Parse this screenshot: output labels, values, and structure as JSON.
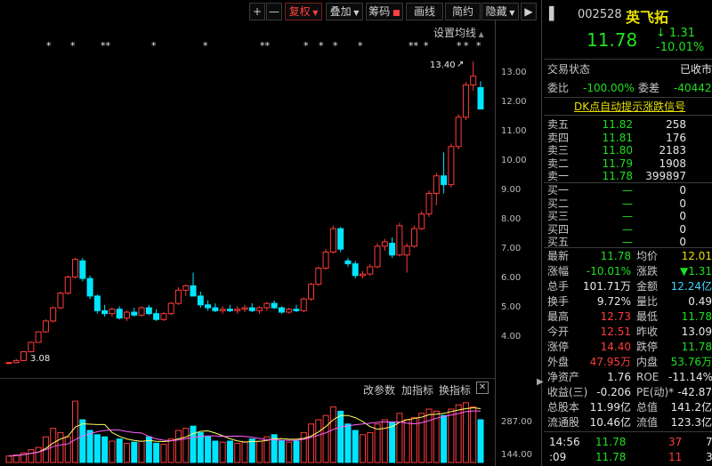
{
  "toolbar": {
    "plus": "+",
    "minus": "—",
    "fuquan": "复权",
    "diejia": "叠加",
    "chouma": "筹码",
    "huaxian": "画线",
    "jianyue": "简约",
    "yincang": "隐藏"
  },
  "chart_header": {
    "settings_link": "设置均线"
  },
  "stars": [
    {
      "t": "*"
    },
    {
      "t": "*"
    },
    {
      "t": "**"
    },
    {
      "t": "*"
    },
    {
      "t": "*"
    },
    {
      "t": "**"
    },
    {
      "t": "*"
    },
    {
      "t": "*"
    },
    {
      "t": "*"
    },
    {
      "t": "*"
    },
    {
      "t": "**"
    },
    {
      "t": "*"
    },
    {
      "t": "*"
    },
    {
      "t": "*"
    },
    {
      "t": "*"
    }
  ],
  "price_axis": [
    "13.00",
    "12.00",
    "11.00",
    "10.00",
    "9.00",
    "8.00",
    "7.00",
    "6.00",
    "5.00",
    "4.00"
  ],
  "annotations": {
    "high": "13.40",
    "low": "3.08"
  },
  "indicator_bar": {
    "change_params": "改参数",
    "add_indicator": "加指标",
    "switch_indicator": "换指标",
    "close": "✕"
  },
  "volume_axis": [
    "287.00",
    "144.00"
  ],
  "chart_data": {
    "type": "candlestick",
    "ylim": [
      3.0,
      13.8
    ],
    "candles": [
      [
        3.12,
        3.15,
        3.08,
        3.13
      ],
      [
        3.13,
        3.25,
        3.1,
        3.2
      ],
      [
        3.2,
        3.52,
        3.18,
        3.5
      ],
      [
        3.5,
        3.85,
        3.48,
        3.82
      ],
      [
        3.82,
        4.2,
        3.8,
        4.18
      ],
      [
        4.18,
        4.6,
        4.15,
        4.55
      ],
      [
        4.55,
        5.05,
        4.5,
        5.0
      ],
      [
        5.0,
        5.55,
        4.95,
        5.5
      ],
      [
        5.5,
        6.1,
        5.45,
        6.05
      ],
      [
        6.05,
        6.7,
        6.0,
        6.65
      ],
      [
        6.6,
        6.7,
        5.9,
        6.0
      ],
      [
        6.0,
        6.1,
        5.3,
        5.4
      ],
      [
        5.4,
        5.45,
        4.8,
        4.9
      ],
      [
        4.9,
        5.1,
        4.7,
        4.8
      ],
      [
        4.8,
        5.0,
        4.7,
        4.95
      ],
      [
        4.95,
        5.05,
        4.6,
        4.65
      ],
      [
        4.65,
        4.9,
        4.55,
        4.85
      ],
      [
        4.85,
        5.0,
        4.7,
        4.75
      ],
      [
        4.75,
        5.05,
        4.7,
        5.0
      ],
      [
        5.0,
        5.1,
        4.75,
        4.8
      ],
      [
        4.8,
        4.95,
        4.55,
        4.6
      ],
      [
        4.6,
        4.85,
        4.55,
        4.8
      ],
      [
        4.8,
        5.2,
        4.75,
        5.15
      ],
      [
        5.15,
        5.7,
        5.1,
        5.6
      ],
      [
        5.6,
        5.8,
        5.4,
        5.75
      ],
      [
        5.75,
        6.2,
        5.7,
        5.4
      ],
      [
        5.4,
        5.55,
        5.0,
        5.1
      ],
      [
        5.1,
        5.25,
        4.9,
        5.0
      ],
      [
        5.0,
        5.15,
        4.85,
        4.9
      ],
      [
        4.9,
        5.05,
        4.8,
        4.95
      ],
      [
        4.95,
        5.1,
        4.85,
        4.9
      ],
      [
        4.9,
        5.05,
        4.8,
        4.95
      ],
      [
        4.95,
        5.1,
        4.85,
        5.0
      ],
      [
        5.0,
        5.15,
        4.85,
        4.9
      ],
      [
        4.9,
        5.05,
        4.8,
        5.0
      ],
      [
        5.0,
        5.2,
        4.9,
        5.15
      ],
      [
        5.15,
        5.25,
        4.95,
        5.0
      ],
      [
        5.0,
        5.05,
        4.8,
        4.85
      ],
      [
        4.85,
        5.0,
        4.8,
        4.95
      ],
      [
        4.95,
        5.1,
        4.85,
        4.9
      ],
      [
        4.9,
        5.35,
        4.85,
        5.3
      ],
      [
        5.3,
        5.85,
        5.25,
        5.8
      ],
      [
        5.8,
        6.4,
        5.75,
        6.35
      ],
      [
        6.35,
        7.0,
        6.3,
        6.9
      ],
      [
        6.9,
        7.8,
        6.85,
        7.7
      ],
      [
        7.7,
        7.75,
        6.9,
        7.0
      ],
      [
        6.6,
        6.7,
        6.4,
        6.5
      ],
      [
        6.5,
        6.6,
        6.0,
        6.1
      ],
      [
        6.1,
        6.25,
        6.0,
        6.15
      ],
      [
        6.15,
        6.5,
        6.1,
        6.4
      ],
      [
        6.4,
        7.2,
        6.35,
        7.1
      ],
      [
        7.1,
        7.35,
        6.95,
        7.25
      ],
      [
        7.2,
        7.4,
        6.7,
        6.8
      ],
      [
        6.8,
        7.9,
        6.75,
        7.8
      ],
      [
        6.8,
        7.2,
        6.2,
        7.1
      ],
      [
        7.1,
        7.8,
        7.05,
        7.7
      ],
      [
        7.7,
        8.3,
        7.65,
        8.2
      ],
      [
        8.2,
        9.0,
        8.1,
        8.9
      ],
      [
        8.9,
        9.6,
        8.5,
        9.5
      ],
      [
        9.5,
        10.3,
        8.9,
        9.2
      ],
      [
        9.2,
        10.6,
        9.1,
        10.5
      ],
      [
        10.5,
        11.6,
        10.4,
        11.5
      ],
      [
        11.5,
        12.7,
        11.4,
        12.6
      ],
      [
        12.6,
        13.4,
        12.4,
        12.9
      ],
      [
        12.51,
        12.73,
        11.78,
        11.78
      ]
    ],
    "volume": [
      30,
      35,
      45,
      60,
      70,
      120,
      160,
      140,
      120,
      287,
      200,
      150,
      130,
      120,
      100,
      110,
      90,
      95,
      100,
      120,
      90,
      85,
      110,
      150,
      160,
      170,
      140,
      120,
      100,
      95,
      100,
      90,
      95,
      110,
      100,
      120,
      130,
      100,
      95,
      100,
      140,
      180,
      200,
      220,
      260,
      240,
      180,
      150,
      130,
      140,
      180,
      200,
      190,
      230,
      200,
      210,
      230,
      250,
      240,
      220,
      250,
      270,
      280,
      260,
      200
    ]
  },
  "stock": {
    "code": "002528",
    "name": "英飞拓",
    "price": "11.78",
    "change": "1.31",
    "pct": "10.01%"
  },
  "status": {
    "label": "交易状态",
    "value": "已收市"
  },
  "weibi": {
    "label1": "委比",
    "value1": "-100.00%",
    "label2": "委差",
    "value2": "-40442"
  },
  "dk_signal": "DK点自动提示涨跌信号",
  "asks": [
    {
      "label": "卖五",
      "price": "11.82",
      "vol": "258"
    },
    {
      "label": "卖四",
      "price": "11.81",
      "vol": "176"
    },
    {
      "label": "卖三",
      "price": "11.80",
      "vol": "2183"
    },
    {
      "label": "卖二",
      "price": "11.79",
      "vol": "1908"
    },
    {
      "label": "卖一",
      "price": "11.78",
      "vol": "399897"
    }
  ],
  "bids": [
    {
      "label": "买一",
      "price": "—",
      "vol": "0"
    },
    {
      "label": "买二",
      "price": "—",
      "vol": "0"
    },
    {
      "label": "买三",
      "price": "—",
      "vol": "0"
    },
    {
      "label": "买四",
      "price": "—",
      "vol": "0"
    },
    {
      "label": "买五",
      "price": "—",
      "vol": "0"
    }
  ],
  "stats": [
    {
      "l1": "最新",
      "v1": "11.78",
      "l2": "均价",
      "v2": "12.01"
    },
    {
      "l1": "涨幅",
      "v1": "-10.01%",
      "l2": "涨跌",
      "v2": "▼1.31"
    },
    {
      "l1": "总手",
      "v1": "101.71万",
      "l2": "金额",
      "v2": "12.24亿"
    },
    {
      "l1": "换手",
      "v1": "9.72%",
      "l2": "量比",
      "v2": "0.49"
    },
    {
      "l1": "最高",
      "v1": "12.73",
      "l2": "最低",
      "v2": "11.78"
    },
    {
      "l1": "今开",
      "v1": "12.51",
      "l2": "昨收",
      "v2": "13.09"
    },
    {
      "l1": "涨停",
      "v1": "14.40",
      "l2": "跌停",
      "v2": "11.78"
    },
    {
      "l1": "外盘",
      "v1": "47.95万",
      "l2": "内盘",
      "v2": "53.76万"
    },
    {
      "l1": "净资产",
      "v1": "1.76",
      "l2": "ROE",
      "v2": "-11.14%"
    },
    {
      "l1": "收益(三)",
      "v1": "-0.206",
      "l2": "PE(动)*",
      "v2": "-42.87"
    },
    {
      "l1": "总股本",
      "v1": "11.99亿",
      "l2": "总值",
      "v2": "141.2亿"
    },
    {
      "l1": "流通股",
      "v1": "10.46亿",
      "l2": "流值",
      "v2": "123.3亿"
    }
  ],
  "ticks": [
    {
      "time": "14:56",
      "price": "11.78",
      "vol": "37",
      "dir": "7"
    },
    {
      "time": ":09",
      "price": "11.78",
      "vol": "11",
      "dir": "3"
    }
  ]
}
